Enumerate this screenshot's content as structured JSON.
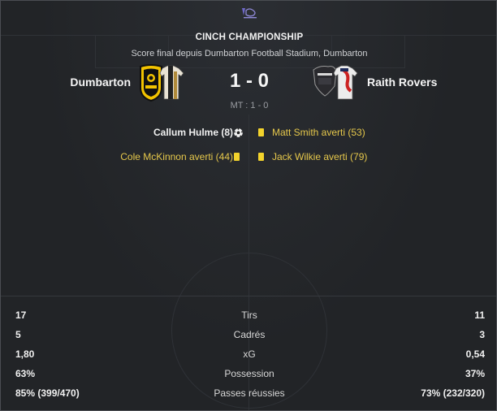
{
  "competition": {
    "title": "CINCH CHAMPIONSHIP",
    "subtitle": "Score final depuis Dumbarton Football Stadium, Dumbarton"
  },
  "match": {
    "home_team": "Dumbarton",
    "away_team": "Raith Rovers",
    "score": "1 - 0",
    "half_time": "MT : 1 - 0"
  },
  "events": {
    "home": [
      {
        "text": "Callum Hulme (8)",
        "type": "goal",
        "icon": "football-icon"
      },
      {
        "text": "Cole McKinnon averti (44)",
        "type": "yellow-card",
        "icon": "yellow-card-icon"
      }
    ],
    "away": [
      {
        "text": "Matt Smith averti (53)",
        "type": "yellow-card",
        "icon": "yellow-card-icon"
      },
      {
        "text": "Jack Wilkie averti (79)",
        "type": "yellow-card",
        "icon": "yellow-card-icon"
      }
    ]
  },
  "stats": [
    {
      "label": "Tirs",
      "home": "17",
      "away": "11"
    },
    {
      "label": "Cadrés",
      "home": "5",
      "away": "3"
    },
    {
      "label": "xG",
      "home": "1,80",
      "away": "0,54"
    },
    {
      "label": "Possession",
      "home": "63%",
      "away": "37%"
    },
    {
      "label": "Passes réussies",
      "home": "85% (399/470)",
      "away": "73% (232/320)"
    }
  ],
  "colors": {
    "background": "#222427",
    "card_yellow": "#f3d32c",
    "yellow_text": "#e6c84b"
  }
}
